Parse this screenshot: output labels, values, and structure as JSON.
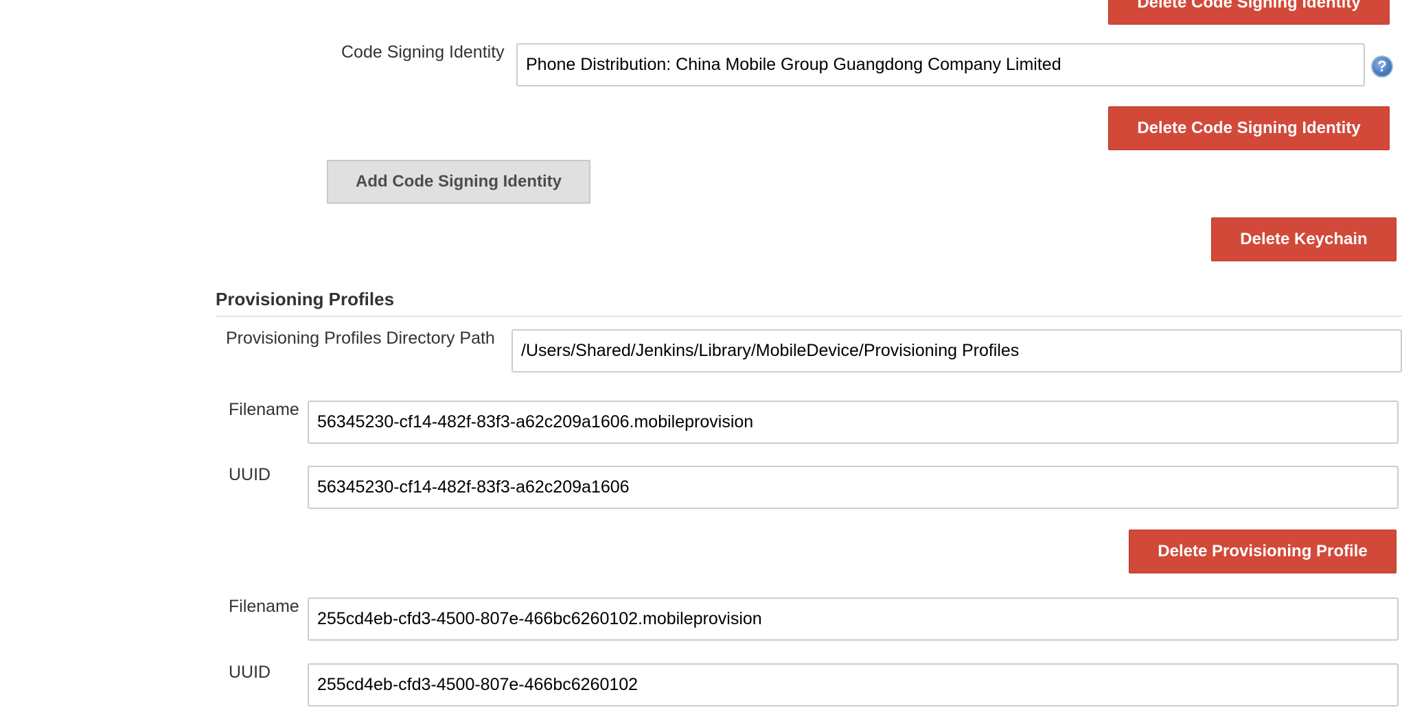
{
  "code_signing": {
    "label": "Code Signing Identity",
    "value": "Phone Distribution: China Mobile Group Guangdong Company Limited",
    "delete_label": "Delete Code Signing Identity",
    "add_label": "Add Code Signing Identity",
    "help_glyph": "?"
  },
  "keychain": {
    "delete_label": "Delete Keychain"
  },
  "provisioning": {
    "section_title": "Provisioning Profiles",
    "dir_label": "Provisioning Profiles Directory Path",
    "dir_value": "/Users/Shared/Jenkins/Library/MobileDevice/Provisioning Profiles",
    "profiles": [
      {
        "filename_label": "Filename",
        "filename": "56345230-cf14-482f-83f3-a62c209a1606.mobileprovision",
        "uuid_label": "UUID",
        "uuid": "56345230-cf14-482f-83f3-a62c209a1606",
        "delete_label": "Delete Provisioning Profile"
      },
      {
        "filename_label": "Filename",
        "filename": "255cd4eb-cfd3-4500-807e-466bc6260102.mobileprovision",
        "uuid_label": "UUID",
        "uuid": "255cd4eb-cfd3-4500-807e-466bc6260102"
      }
    ]
  },
  "colors": {
    "danger": "#d24939",
    "secondary": "#e0e0e0",
    "help": "#4a7ec2"
  }
}
